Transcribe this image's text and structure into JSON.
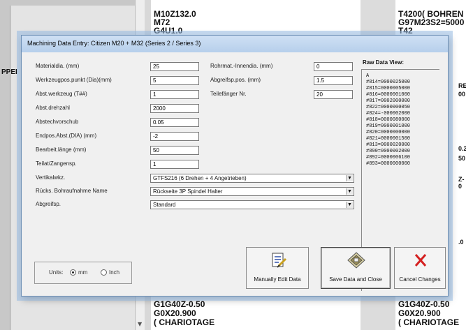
{
  "background": {
    "left_code_lines": [
      "M10Z132.0",
      "M72",
      "G4U1.0"
    ],
    "right_code_lines": [
      "T4200( BOHREN",
      "G97M23S2=5000",
      "T42"
    ],
    "left_panel_fragment": "PPEI",
    "right_fragments": [
      "RE",
      "00",
      "0.2",
      "50",
      "Z-0",
      ".0"
    ],
    "bottom_code_lines": [
      "G1G40Z-0.50",
      "G0X20.900",
      "( CHARIOTAGE"
    ]
  },
  "dialog": {
    "title": "Machining Data Entry:  Citizen M20 + M32 (Series 2 / Series 3)",
    "left_fields": [
      {
        "label": "Materialdia. (mm)",
        "value": "25"
      },
      {
        "label": "Werkzeugpos.punkt (Dia)(mm)",
        "value": "5"
      },
      {
        "label": "Abst.werkzeug (T##)",
        "value": "1"
      },
      {
        "label": "Abst.drehzahl",
        "value": "2000"
      },
      {
        "label": "Abstechvorschub",
        "value": "0.05"
      },
      {
        "label": "Endpos.Abst.(DIA) (mm)",
        "value": "-2"
      },
      {
        "label": "Bearbeit.länge (mm)",
        "value": "50"
      },
      {
        "label": "Teilat/Zangensp.",
        "value": "1"
      }
    ],
    "right_fields": [
      {
        "label": "Rohrmat.-Innendia. (mm)",
        "value": "0"
      },
      {
        "label": "Abgreifsp.pos. (mm)",
        "value": "1.5"
      },
      {
        "label": "Teilefänger Nr.",
        "value": "20"
      }
    ],
    "selects": [
      {
        "label": "Vertikalwkz.",
        "value": "GTFS216 (6 Drehen + 4 Angetrieben)"
      },
      {
        "label": "Rücks. Bohraufnahme Name",
        "value": "Rückseite 3P Spindel Halter"
      },
      {
        "label": "Abgreifsp.",
        "value": "Standard"
      }
    ],
    "raw_data": {
      "title": "Raw Data View:",
      "lines": [
        "A",
        "#814=0000025000",
        "#815=0000005000",
        "#816=0000001000",
        "#817=0002000000",
        "#822=0000000050",
        "#824=-000002000",
        "#818=0000080000",
        "#819=0000001000",
        "#820=0000000000",
        "#821=0000001500",
        "#813=0000020000",
        "#890=0000002000",
        "#892=0000006100",
        "#893=0000000000"
      ]
    },
    "units": {
      "label": "Units:",
      "mm": "mm",
      "inch": "Inch",
      "selected": "mm"
    },
    "buttons": {
      "manual": "Manually Edit Data",
      "save": "Save Data and Close",
      "cancel": "Cancel Changes"
    },
    "colors": {
      "cancel_x": "#d42020",
      "edit_icon": "#2f4fa8",
      "save_icon": "#9a8e5a"
    },
    "icons": {
      "manual": "edit-document-icon",
      "save": "save-disk-icon",
      "cancel": "close-x-icon"
    }
  }
}
